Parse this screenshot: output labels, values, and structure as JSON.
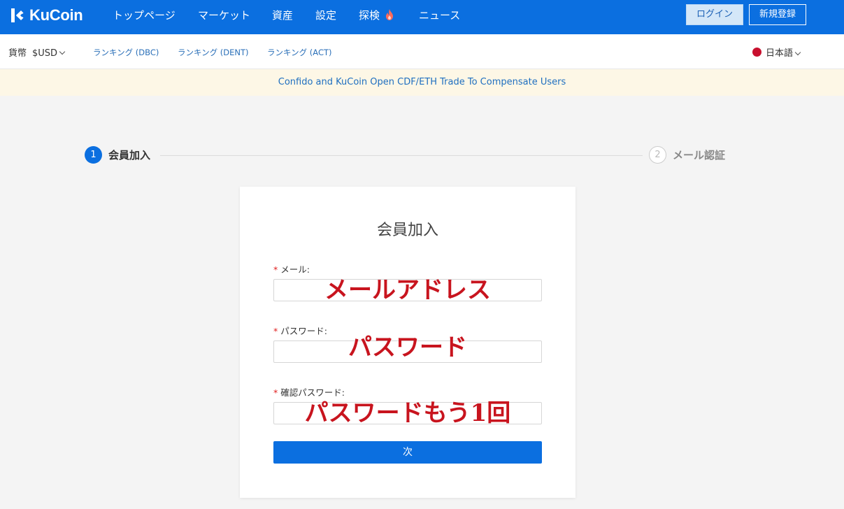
{
  "brand": {
    "name": "KuCoin",
    "accent": "#0b6fe0"
  },
  "nav": {
    "items": [
      {
        "label": "トップページ"
      },
      {
        "label": "マーケット"
      },
      {
        "label": "資産"
      },
      {
        "label": "設定"
      },
      {
        "label": "探検",
        "icon": "flame-icon"
      },
      {
        "label": "ニュース"
      }
    ],
    "login_label": "ログイン",
    "signup_label": "新規登録"
  },
  "subbar": {
    "currency_label": "貨幣",
    "currency_value": "$USD",
    "rankings": [
      "ランキング (DBC)",
      "ランキング (DENT)",
      "ランキング (ACT)"
    ],
    "language": "日本語"
  },
  "announcement": "Confido and KuCoin Open CDF/ETH Trade To Compensate Users",
  "steps": [
    {
      "number": "1",
      "label": "会員加入",
      "active": true
    },
    {
      "number": "2",
      "label": "メール認証",
      "active": false
    }
  ],
  "form": {
    "title": "会員加入",
    "fields": [
      {
        "label": "メール:",
        "required_mark": "*",
        "annotation": "メールアドレス",
        "value": ""
      },
      {
        "label": "パスワード:",
        "required_mark": "*",
        "annotation": "パスワード",
        "value": ""
      },
      {
        "label": "確認パスワード:",
        "required_mark": "*",
        "annotation": "パスワードもう1回",
        "value": ""
      }
    ],
    "submit_label": "次"
  }
}
